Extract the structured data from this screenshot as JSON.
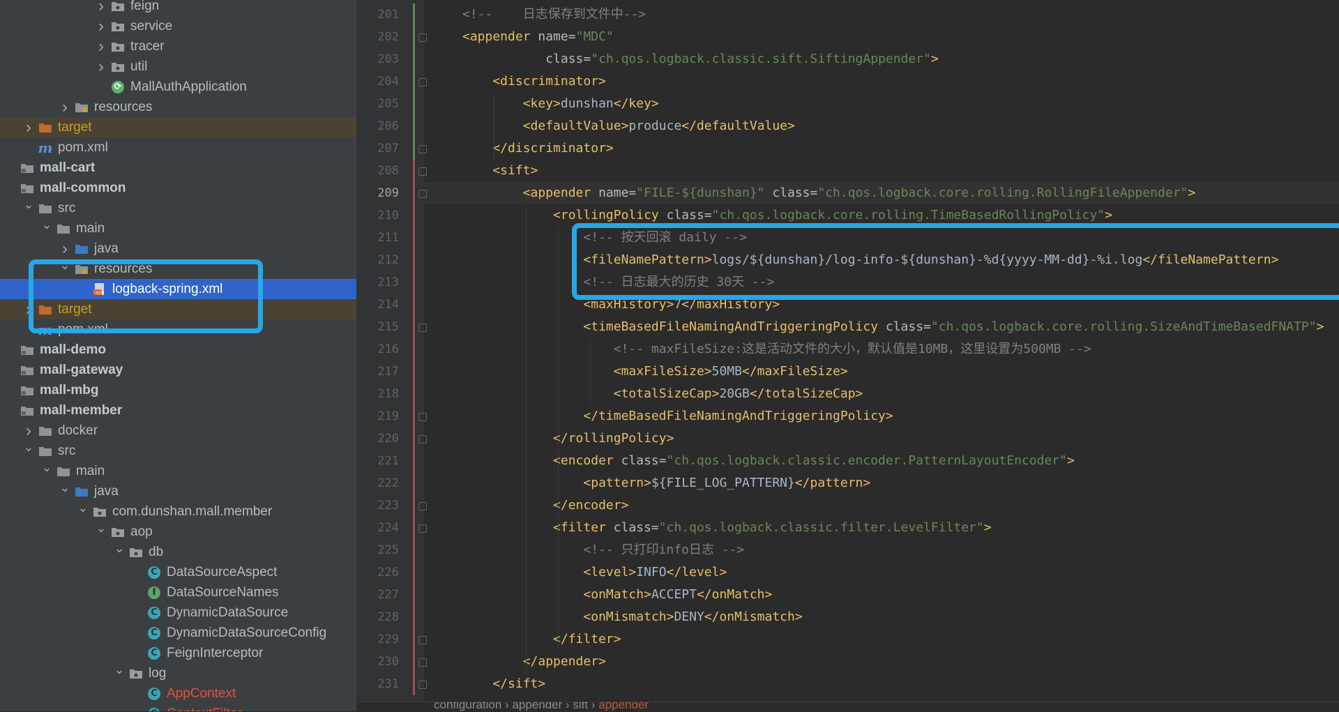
{
  "tree": [
    {
      "label": "feign",
      "kind": "pkg",
      "indent": 5,
      "arrow": "right"
    },
    {
      "label": "service",
      "kind": "pkg",
      "indent": 5,
      "arrow": "right"
    },
    {
      "label": "tracer",
      "kind": "pkg",
      "indent": 5,
      "arrow": "right"
    },
    {
      "label": "util",
      "kind": "pkg",
      "indent": 5,
      "arrow": "right"
    },
    {
      "label": "MallAuthApplication",
      "kind": "app",
      "indent": 5,
      "arrow": ""
    },
    {
      "label": "resources",
      "kind": "res",
      "indent": 3,
      "arrow": "right"
    },
    {
      "label": "target",
      "kind": "folder-excl",
      "indent": 1,
      "arrow": "right",
      "style": "target",
      "row": "excl"
    },
    {
      "label": "pom.xml",
      "kind": "pom",
      "indent": 1,
      "arrow": ""
    },
    {
      "label": "mall-cart",
      "kind": "module",
      "indent": 0,
      "arrow": "",
      "style": "bold"
    },
    {
      "label": "mall-common",
      "kind": "module",
      "indent": 0,
      "arrow": "",
      "style": "bold"
    },
    {
      "label": "src",
      "kind": "folder",
      "indent": 1,
      "arrow": "down"
    },
    {
      "label": "main",
      "kind": "folder",
      "indent": 2,
      "arrow": "down"
    },
    {
      "label": "java",
      "kind": "src",
      "indent": 3,
      "arrow": "right"
    },
    {
      "label": "resources",
      "kind": "res",
      "indent": 3,
      "arrow": "down"
    },
    {
      "label": "logback-spring.xml",
      "kind": "xml",
      "indent": 4,
      "arrow": "",
      "row": "sel"
    },
    {
      "label": "target",
      "kind": "folder-excl",
      "indent": 1,
      "arrow": "right",
      "style": "target",
      "row": "excl"
    },
    {
      "label": "pom.xml",
      "kind": "pom",
      "indent": 1,
      "arrow": ""
    },
    {
      "label": "mall-demo",
      "kind": "module",
      "indent": 0,
      "arrow": "",
      "style": "bold"
    },
    {
      "label": "mall-gateway",
      "kind": "module",
      "indent": 0,
      "arrow": "",
      "style": "bold"
    },
    {
      "label": "mall-mbg",
      "kind": "module",
      "indent": 0,
      "arrow": "",
      "style": "bold"
    },
    {
      "label": "mall-member",
      "kind": "module",
      "indent": 0,
      "arrow": "",
      "style": "bold"
    },
    {
      "label": "docker",
      "kind": "folder",
      "indent": 1,
      "arrow": "right"
    },
    {
      "label": "src",
      "kind": "folder",
      "indent": 1,
      "arrow": "down"
    },
    {
      "label": "main",
      "kind": "folder",
      "indent": 2,
      "arrow": "down"
    },
    {
      "label": "java",
      "kind": "src",
      "indent": 3,
      "arrow": "down"
    },
    {
      "label": "com.dunshan.mall.member",
      "kind": "pkg",
      "indent": 4,
      "arrow": "down"
    },
    {
      "label": "aop",
      "kind": "pkg",
      "indent": 5,
      "arrow": "down"
    },
    {
      "label": "db",
      "kind": "pkg",
      "indent": 6,
      "arrow": "down"
    },
    {
      "label": "DataSourceAspect",
      "kind": "class",
      "indent": 7,
      "arrow": ""
    },
    {
      "label": "DataSourceNames",
      "kind": "iface",
      "indent": 7,
      "arrow": ""
    },
    {
      "label": "DynamicDataSource",
      "kind": "class",
      "indent": 7,
      "arrow": ""
    },
    {
      "label": "DynamicDataSourceConfig",
      "kind": "class",
      "indent": 7,
      "arrow": ""
    },
    {
      "label": "FeignInterceptor",
      "kind": "class",
      "indent": 7,
      "arrow": ""
    },
    {
      "label": "log",
      "kind": "pkg",
      "indent": 6,
      "arrow": "down"
    },
    {
      "label": "AppContext",
      "kind": "class",
      "indent": 7,
      "arrow": "",
      "style": "red"
    },
    {
      "label": "ContextFilter",
      "kind": "class",
      "indent": 7,
      "arrow": "",
      "style": "red"
    }
  ],
  "line_numbers": [
    "201",
    "202",
    "203",
    "204",
    "205",
    "206",
    "207",
    "208",
    "209",
    "210",
    "211",
    "212",
    "213",
    "214",
    "215",
    "216",
    "217",
    "218",
    "219",
    "220",
    "221",
    "222",
    "223",
    "224",
    "225",
    "226",
    "227",
    "228",
    "229",
    "230",
    "231"
  ],
  "current_line": "209",
  "code": [
    [
      [
        "cm",
        "<!--    日志保存到文件中-->"
      ]
    ],
    [
      [
        "tg",
        "<appender"
      ],
      [
        "at",
        " name="
      ],
      [
        "av",
        "\"MDC\""
      ]
    ],
    [
      [
        "at",
        "           class="
      ],
      [
        "av",
        "\"ch.qos.logback.classic.sift.SiftingAppender\""
      ],
      [
        "tg",
        ">"
      ]
    ],
    [
      [
        "tg",
        "    <discriminator>"
      ]
    ],
    [
      [
        "tg",
        "        <key>"
      ],
      [
        "tx",
        "dunshan"
      ],
      [
        "tg",
        "</key>"
      ]
    ],
    [
      [
        "tg",
        "        <defaultValue>"
      ],
      [
        "tx",
        "produce"
      ],
      [
        "tg",
        "</defaultValue>"
      ]
    ],
    [
      [
        "tg",
        "    </discriminator>"
      ]
    ],
    [
      [
        "tg",
        "    <sift>"
      ]
    ],
    [
      [
        "tg",
        "        <appender"
      ],
      [
        "at",
        " name="
      ],
      [
        "av",
        "\"FILE-${dunshan}\""
      ],
      [
        "at",
        " class="
      ],
      [
        "av",
        "\"ch.qos.logback.core.rolling.RollingFileAppender\""
      ],
      [
        "tg",
        ">"
      ]
    ],
    [
      [
        "tg",
        "            <rollingPolicy"
      ],
      [
        "at",
        " class="
      ],
      [
        "av",
        "\"ch.qos.logback.core.rolling.TimeBasedRollingPolicy\""
      ],
      [
        "tg",
        ">"
      ]
    ],
    [
      [
        "cm",
        "                <!-- 按天回滚 daily -->"
      ]
    ],
    [
      [
        "tg",
        "                <fileNamePattern>"
      ],
      [
        "tx",
        "logs/${dunshan}/log-info-${dunshan}-%d{yyyy-MM-dd}-%i.log"
      ],
      [
        "tg",
        "</fileNamePattern>"
      ]
    ],
    [
      [
        "cm",
        "                <!-- 日志最大的历史 30天 -->"
      ]
    ],
    [
      [
        "tg",
        "                <maxHistory>"
      ],
      [
        "tx",
        "7"
      ],
      [
        "tg",
        "</maxHistory>"
      ]
    ],
    [
      [
        "tg",
        "                <timeBasedFileNamingAndTriggeringPolicy"
      ],
      [
        "at",
        " class="
      ],
      [
        "av",
        "\"ch.qos.logback.core.rolling.SizeAndTimeBasedFNATP\""
      ],
      [
        "tg",
        ">"
      ]
    ],
    [
      [
        "cm",
        "                    <!-- maxFileSize:这是活动文件的大小，默认值是10MB，这里设置为500MB -->"
      ]
    ],
    [
      [
        "tg",
        "                    <maxFileSize>"
      ],
      [
        "tx",
        "50MB"
      ],
      [
        "tg",
        "</maxFileSize>"
      ]
    ],
    [
      [
        "tg",
        "                    <totalSizeCap>"
      ],
      [
        "tx",
        "20GB"
      ],
      [
        "tg",
        "</totalSizeCap>"
      ]
    ],
    [
      [
        "tg",
        "                </timeBasedFileNamingAndTriggeringPolicy>"
      ]
    ],
    [
      [
        "tg",
        "            </rollingPolicy>"
      ]
    ],
    [
      [
        "tg",
        "            <encoder"
      ],
      [
        "at",
        " class="
      ],
      [
        "av",
        "\"ch.qos.logback.classic.encoder.PatternLayoutEncoder\""
      ],
      [
        "tg",
        ">"
      ]
    ],
    [
      [
        "tg",
        "                <pattern>"
      ],
      [
        "tx",
        "${FILE_LOG_PATTERN}"
      ],
      [
        "tg",
        "</pattern>"
      ]
    ],
    [
      [
        "tg",
        "            </encoder>"
      ]
    ],
    [
      [
        "tg",
        "            <filter"
      ],
      [
        "at",
        " class="
      ],
      [
        "av",
        "\"ch.qos.logback.classic.filter.LevelFilter\""
      ],
      [
        "tg",
        ">"
      ]
    ],
    [
      [
        "cm",
        "                <!-- 只打印info日志 -->"
      ]
    ],
    [
      [
        "tg",
        "                <level>"
      ],
      [
        "tx",
        "INFO"
      ],
      [
        "tg",
        "</level>"
      ]
    ],
    [
      [
        "tg",
        "                <onMatch>"
      ],
      [
        "tx",
        "ACCEPT"
      ],
      [
        "tg",
        "</onMatch>"
      ]
    ],
    [
      [
        "tg",
        "                <onMismatch>"
      ],
      [
        "tx",
        "DENY"
      ],
      [
        "tg",
        "</onMismatch>"
      ]
    ],
    [
      [
        "tg",
        "            </filter>"
      ]
    ],
    [
      [
        "tg",
        "        </appender>"
      ]
    ],
    [
      [
        "tg",
        "    </sift>"
      ]
    ]
  ],
  "breadcrumbs": [
    "configuration",
    "appender",
    "sift",
    "appender"
  ],
  "colors": {
    "highlight": "#28a7e6",
    "selection": "#2f65ca",
    "tag": "#e8bf6a",
    "attr_value": "#6a8759",
    "comment": "#808080"
  }
}
